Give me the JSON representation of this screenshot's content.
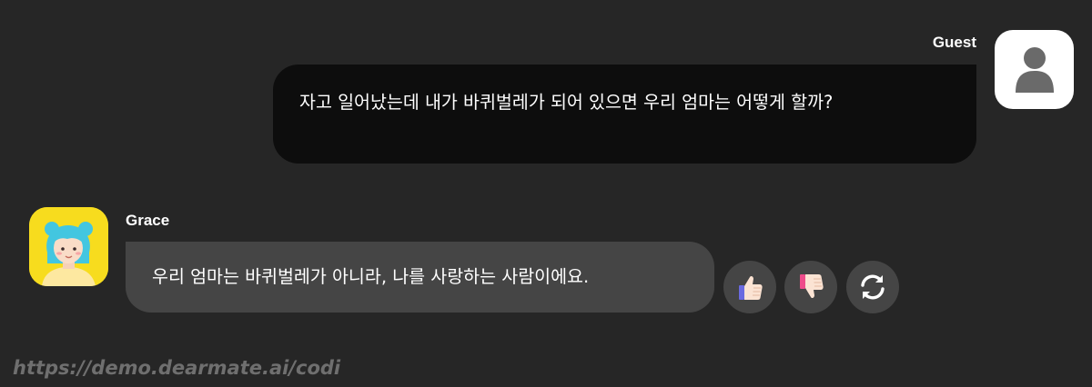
{
  "guest": {
    "name": "Guest",
    "message": "자고 일어났는데 내가 바퀴벌레가 되어 있으면 우리 엄마는 어떻게 할까?",
    "avatar_icon": "user-silhouette-icon"
  },
  "bot": {
    "name": "Grace",
    "message": "우리 엄마는 바퀴벌레가 아니라, 나를 사랑하는 사람이에요.",
    "avatar_icon": "grace-avatar-illustration"
  },
  "actions": {
    "like_icon": "thumbs-up-icon",
    "dislike_icon": "thumbs-down-icon",
    "regenerate_icon": "refresh-icon"
  },
  "watermark": "https://demo.dearmate.ai/codi",
  "colors": {
    "background": "#262626",
    "guest_bubble": "#0d0d0d",
    "bot_bubble": "#454545",
    "bot_avatar_bg": "#f7dc1e",
    "watermark": "#6f6f6f"
  }
}
